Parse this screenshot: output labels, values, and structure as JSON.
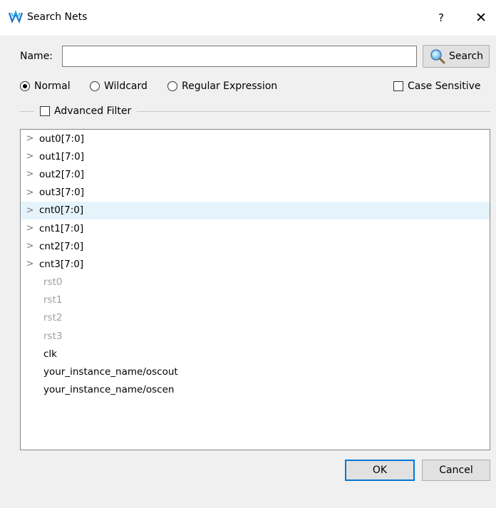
{
  "window": {
    "title": "Search Nets",
    "help_label": "?",
    "close_label": "✕"
  },
  "form": {
    "name_label": "Name:",
    "name_value": "",
    "search_label": "Search",
    "mode_options": [
      "Normal",
      "Wildcard",
      "Regular Expression"
    ],
    "mode_selected": "Normal",
    "case_sensitive_label": "Case Sensitive",
    "case_sensitive_checked": false,
    "advanced_filter_label": "Advanced Filter",
    "advanced_filter_checked": false
  },
  "nets": [
    {
      "label": "out0[7:0]",
      "expandable": true,
      "selected": false,
      "dimmed": false
    },
    {
      "label": "out1[7:0]",
      "expandable": true,
      "selected": false,
      "dimmed": false
    },
    {
      "label": "out2[7:0]",
      "expandable": true,
      "selected": false,
      "dimmed": false
    },
    {
      "label": "out3[7:0]",
      "expandable": true,
      "selected": false,
      "dimmed": false
    },
    {
      "label": "cnt0[7:0]",
      "expandable": true,
      "selected": true,
      "dimmed": false
    },
    {
      "label": "cnt1[7:0]",
      "expandable": true,
      "selected": false,
      "dimmed": false
    },
    {
      "label": "cnt2[7:0]",
      "expandable": true,
      "selected": false,
      "dimmed": false
    },
    {
      "label": "cnt3[7:0]",
      "expandable": true,
      "selected": false,
      "dimmed": false
    },
    {
      "label": "rst0",
      "expandable": false,
      "selected": false,
      "dimmed": true
    },
    {
      "label": "rst1",
      "expandable": false,
      "selected": false,
      "dimmed": true
    },
    {
      "label": "rst2",
      "expandable": false,
      "selected": false,
      "dimmed": true
    },
    {
      "label": "rst3",
      "expandable": false,
      "selected": false,
      "dimmed": true
    },
    {
      "label": "clk",
      "expandable": false,
      "selected": false,
      "dimmed": false
    },
    {
      "label": "your_instance_name/oscout",
      "expandable": false,
      "selected": false,
      "dimmed": false
    },
    {
      "label": "your_instance_name/oscen",
      "expandable": false,
      "selected": false,
      "dimmed": false
    }
  ],
  "buttons": {
    "ok_label": "OK",
    "cancel_label": "Cancel"
  },
  "colors": {
    "selection": "#e5f3fb",
    "accent": "#0078d7",
    "dimmed_text": "#a0a0a0"
  }
}
